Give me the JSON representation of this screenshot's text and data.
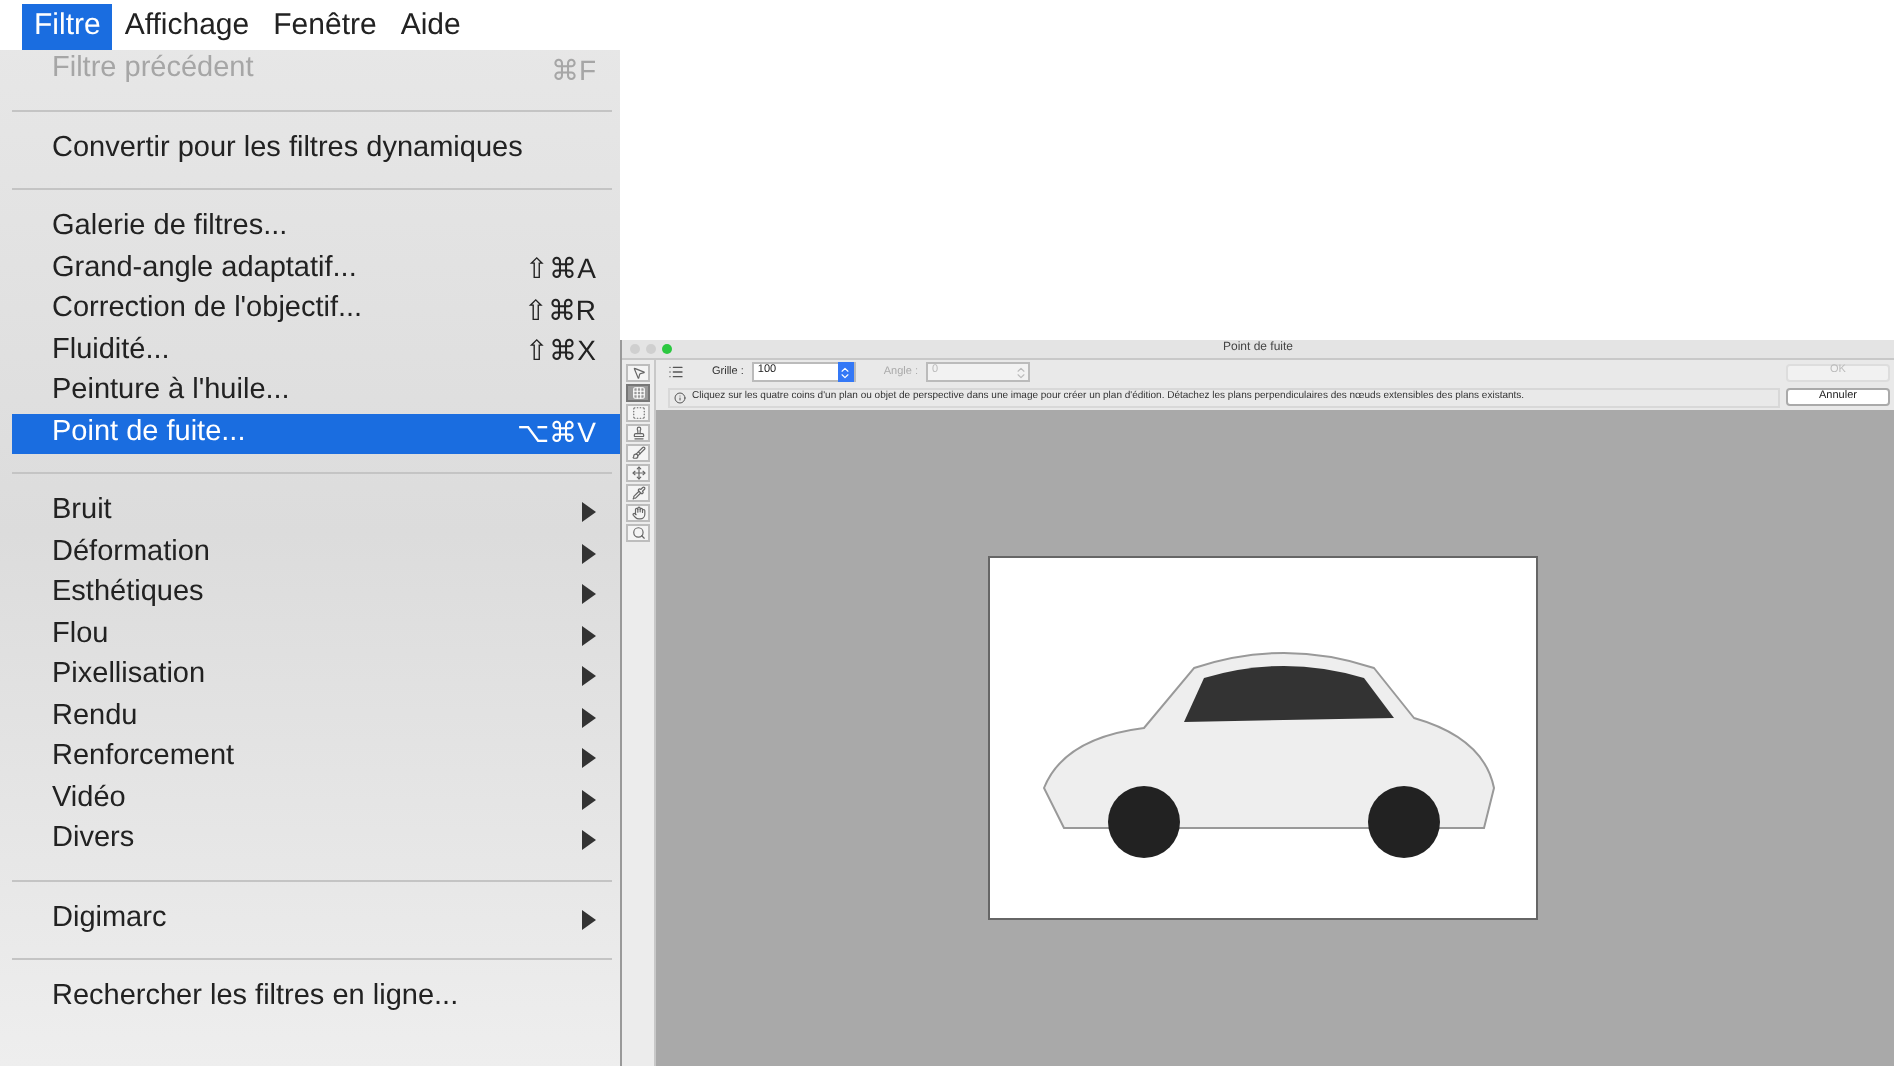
{
  "menubar": [
    {
      "label": "Filtre",
      "selected": true
    },
    {
      "label": "Affichage",
      "selected": false
    },
    {
      "label": "Fenêtre",
      "selected": false
    },
    {
      "label": "Aide",
      "selected": false
    }
  ],
  "menu": {
    "groups": [
      [
        {
          "label": "Filtre précédent",
          "shortcut": "⌘F",
          "disabled": true,
          "selected": false,
          "submenu": false
        }
      ],
      [
        {
          "label": "Convertir pour les filtres dynamiques",
          "disabled": false,
          "selected": false,
          "submenu": false
        }
      ],
      [
        {
          "label": "Galerie de filtres...",
          "disabled": false,
          "selected": false,
          "submenu": false
        },
        {
          "label": "Grand-angle adaptatif...",
          "shortcut": "⇧⌘A",
          "disabled": false,
          "selected": false,
          "submenu": false
        },
        {
          "label": "Correction de l'objectif...",
          "shortcut": "⇧⌘R",
          "disabled": false,
          "selected": false,
          "submenu": false
        },
        {
          "label": "Fluidité...",
          "shortcut": "⇧⌘X",
          "disabled": false,
          "selected": false,
          "submenu": false
        },
        {
          "label": "Peinture à l'huile...",
          "disabled": false,
          "selected": false,
          "submenu": false
        },
        {
          "label": "Point de fuite...",
          "shortcut": "⌥⌘V",
          "disabled": false,
          "selected": true,
          "submenu": false
        }
      ],
      [
        {
          "label": "Bruit",
          "disabled": false,
          "selected": false,
          "submenu": true
        },
        {
          "label": "Déformation",
          "disabled": false,
          "selected": false,
          "submenu": true
        },
        {
          "label": "Esthétiques",
          "disabled": false,
          "selected": false,
          "submenu": true
        },
        {
          "label": "Flou",
          "disabled": false,
          "selected": false,
          "submenu": true
        },
        {
          "label": "Pixellisation",
          "disabled": false,
          "selected": false,
          "submenu": true
        },
        {
          "label": "Rendu",
          "disabled": false,
          "selected": false,
          "submenu": true
        },
        {
          "label": "Renforcement",
          "disabled": false,
          "selected": false,
          "submenu": true
        },
        {
          "label": "Vidéo",
          "disabled": false,
          "selected": false,
          "submenu": true
        },
        {
          "label": "Divers",
          "disabled": false,
          "selected": false,
          "submenu": true
        }
      ],
      [
        {
          "label": "Digimarc",
          "disabled": false,
          "selected": false,
          "submenu": true
        }
      ],
      [
        {
          "label": "Rechercher les filtres en ligne...",
          "disabled": false,
          "selected": false,
          "submenu": false
        }
      ]
    ]
  },
  "dialog": {
    "title": "Point de fuite",
    "grid": {
      "label": "Grille :",
      "value": "100",
      "disabled": false
    },
    "angle": {
      "label": "Angle :",
      "value": "0",
      "disabled": true
    },
    "ok": {
      "label": "OK",
      "disabled": true
    },
    "cancel": {
      "label": "Annuler",
      "disabled": false
    },
    "message": "Cliquez sur les quatre coins d'un plan ou objet de perspective dans une image pour créer un plan d'édition. Détachez les plans perpendiculaires des nœuds extensibles des plans existants.",
    "tools": [
      {
        "kind": "edit",
        "selected": false
      },
      {
        "kind": "create",
        "selected": true
      },
      {
        "kind": "marquee",
        "selected": false
      },
      {
        "kind": "stamp",
        "selected": false
      },
      {
        "kind": "brush",
        "selected": false
      },
      {
        "kind": "transform",
        "selected": false
      },
      {
        "kind": "eyedropper",
        "selected": false
      },
      {
        "kind": "hand",
        "selected": false
      },
      {
        "kind": "zoom",
        "selected": false
      }
    ]
  }
}
